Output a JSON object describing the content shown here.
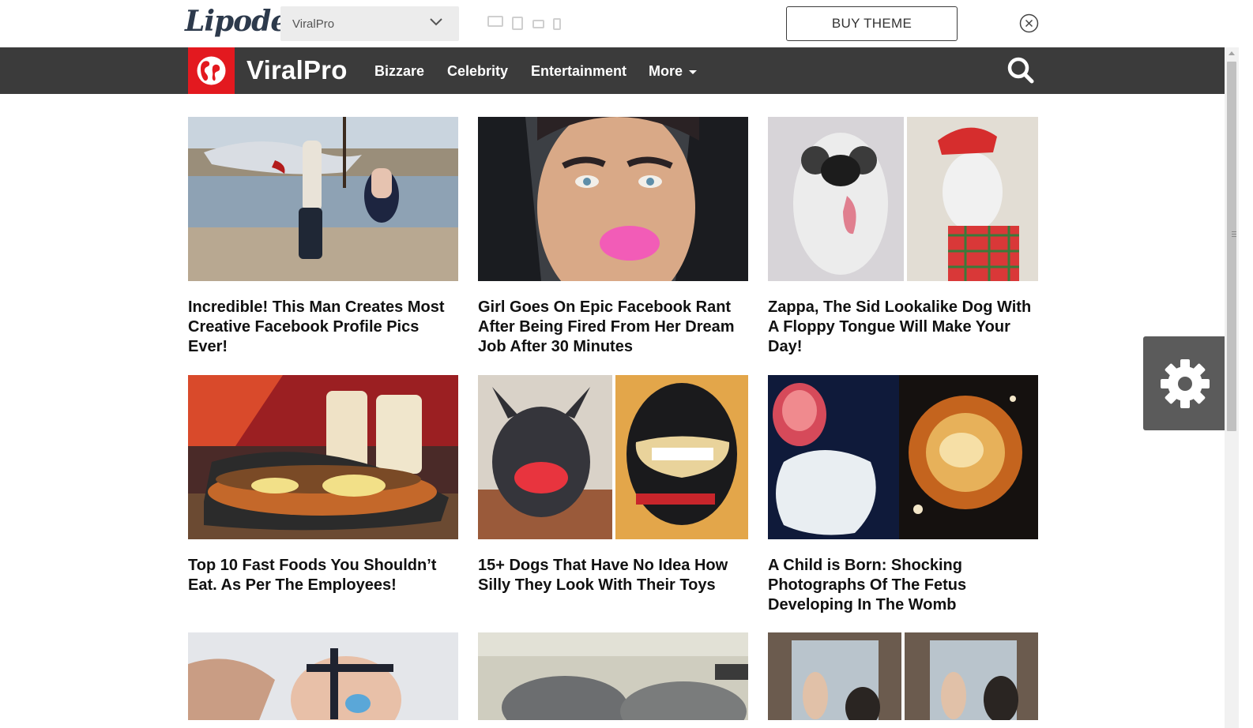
{
  "theme_bar": {
    "brand": "Lipode",
    "theme_select_value": "ViralPro",
    "buy_label": "BUY THEME"
  },
  "nav": {
    "site_name": "ViralPro",
    "items": [
      "Bizzare",
      "Celebrity",
      "Entertainment",
      "More"
    ]
  },
  "posts": [
    {
      "title": "Incredible! This Man Creates Most Creative Facebook Profile Pics Ever!"
    },
    {
      "title": "Girl Goes On Epic Facebook Rant After Being Fired From Her Dream Job After 30 Minutes"
    },
    {
      "title": "Zappa, The Sid Lookalike Dog With A Floppy Tongue Will Make Your Day!"
    },
    {
      "title": "Top 10 Fast Foods You Shouldn’t Eat. As Per The Employees!"
    },
    {
      "title": "15+ Dogs That Have No Idea How Silly They Look With Their Toys"
    },
    {
      "title": "A Child is Born: Shocking Photographs Of The Fetus Developing In The Womb"
    },
    {
      "title": ""
    },
    {
      "title": ""
    },
    {
      "title": ""
    }
  ],
  "colors": {
    "accent": "#e3191f",
    "navbar": "#3b3b3b",
    "settings": "#5b5b5b"
  },
  "icons": [
    "chevron-down-icon",
    "desktop-icon",
    "tablet-icon",
    "tablet-landscape-icon",
    "phone-icon",
    "close-icon",
    "globe-icon",
    "search-icon",
    "gear-icon"
  ]
}
